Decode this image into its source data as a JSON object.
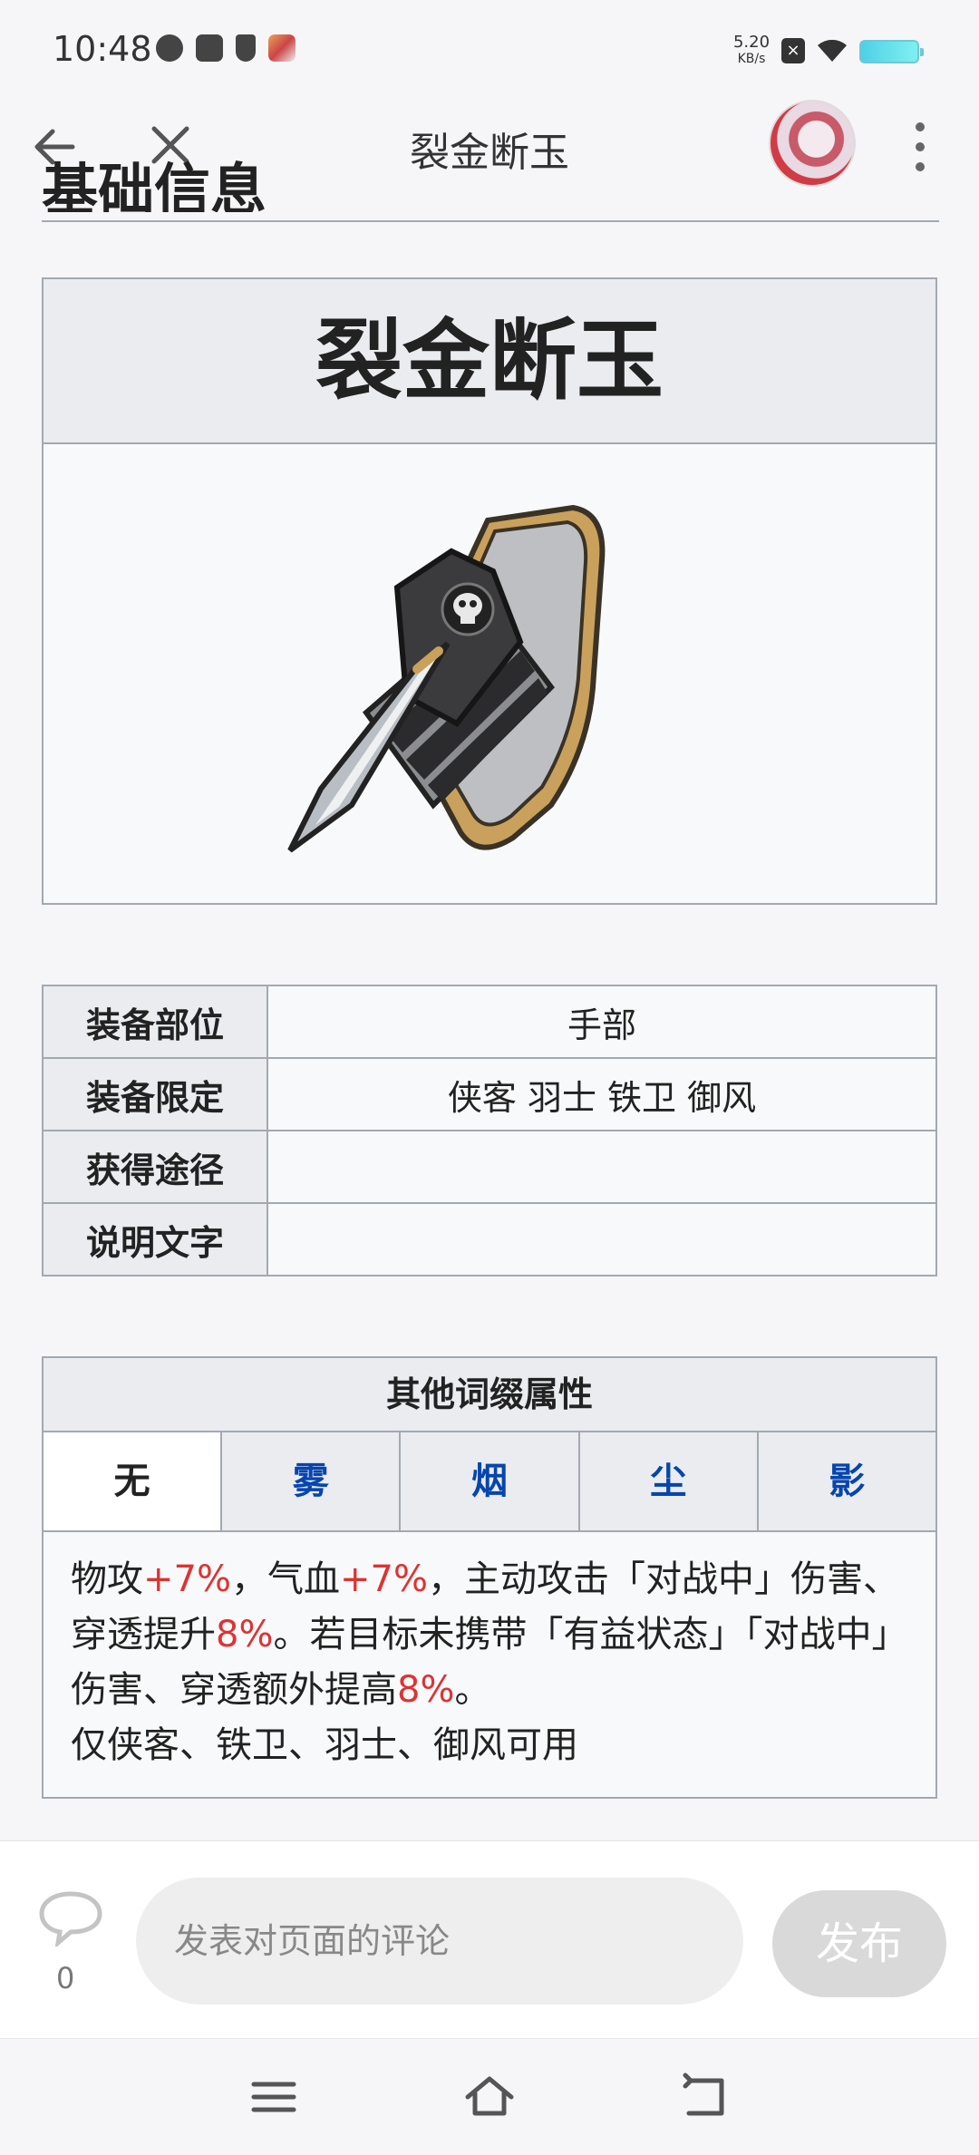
{
  "status_bar": {
    "time": "10:48",
    "net_speed": "5.20",
    "net_unit": "KB/s"
  },
  "header": {
    "title": "裂金断玉",
    "back_icon": "back-arrow-icon",
    "close_icon": "close-icon",
    "more_icon": "more-vertical-icon"
  },
  "section": {
    "heading": "基础信息"
  },
  "infobox": {
    "title": "裂金断玉",
    "image": "gauntlet-image"
  },
  "properties": [
    {
      "key": "装备部位",
      "value": "手部"
    },
    {
      "key": "装备限定",
      "value": "侠客 羽士 铁卫 御风"
    },
    {
      "key": "获得途径",
      "value": ""
    },
    {
      "key": "说明文字",
      "value": ""
    }
  ],
  "affix": {
    "title": "其他词缀属性",
    "tabs": [
      "无",
      "雾",
      "烟",
      "尘",
      "影"
    ],
    "active_tab": 0,
    "desc": {
      "p1": "物攻",
      "v1": "+7%",
      "p2": "，气血",
      "v2": "+7%",
      "p3": "，主动攻击「对战中」伤害、穿透提升",
      "v3": "8%",
      "p4": "。若目标未携带「有益状态」「对战中」伤害、穿透额外提高",
      "v4": "8%",
      "p5": "。",
      "line2": "仅侠客、铁卫、羽士、御风可用"
    }
  },
  "comment_bar": {
    "count": "0",
    "placeholder": "发表对页面的评论",
    "submit_label": "发布"
  },
  "colors": {
    "link": "#0645ad",
    "highlight": "#dd3333",
    "border": "#a2a9b1",
    "header_bg": "#eaecf0"
  }
}
